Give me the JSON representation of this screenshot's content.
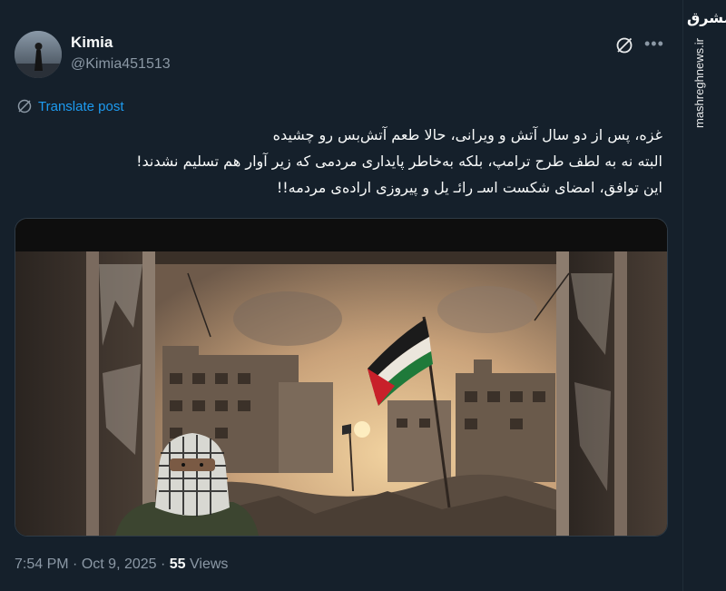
{
  "author": {
    "name": "Kimia",
    "handle": "@Kimia451513"
  },
  "actions": {
    "translate_label": "Translate post"
  },
  "tweet": {
    "lines": [
      "غزه، پس از دو سال آتش و ویرانی، حالا طعم آتش‌بس رو چشیده",
      "البته نه به لطف طرح ترامپ، بلکه به‌خاطر پایداری مردمی که زیر آوار هم تسلیم نشدند!",
      "این توافق، امضای شکست اسـ رائـ یل و پیروزی اراده‌ی مردمه!!"
    ]
  },
  "meta": {
    "time": "7:54 PM",
    "separator": "·",
    "date": "Oct 9, 2025",
    "views_count": "55",
    "views_label": "Views"
  },
  "watermark": {
    "logo": "مشرق",
    "url": "mashreghnews.ir"
  },
  "icons": {
    "grok": "grok-icon",
    "more": "more-icon",
    "translate": "globe-icon"
  },
  "colors": {
    "background": "#15202b",
    "link": "#1d9bf0",
    "secondary_text": "#8b98a5"
  }
}
